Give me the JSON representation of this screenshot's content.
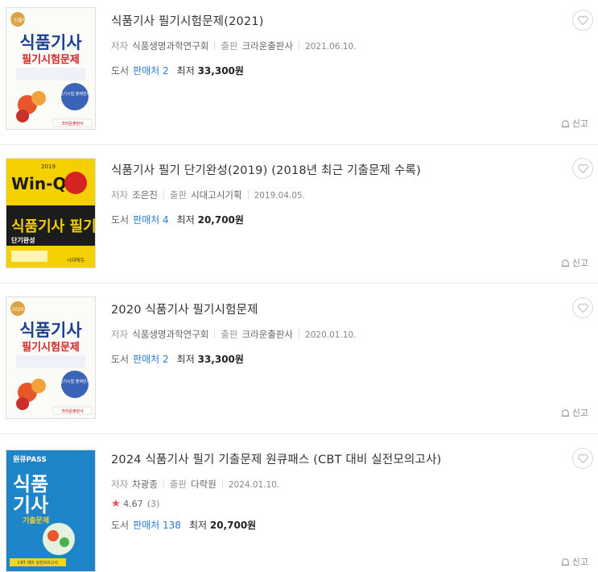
{
  "books": [
    {
      "title": "식품기사 필기시험문제(2021)",
      "author_label": "저자",
      "author": "식품생명과학연구회",
      "publisher_label": "출판",
      "publisher": "크라운출판사",
      "date": "2021.06.10.",
      "type_label": "도서",
      "sellers": "판매처 2",
      "lowest_label": "최저",
      "price": "33,300원",
      "report": "신고",
      "cover": {
        "top": "2021 신출제기준",
        "l1": "식품기사",
        "l2": "필기시험문제",
        "badge": "필기시험 출제빈도",
        "pub": "크라운출판사",
        "theme": "white"
      }
    },
    {
      "title": "식품기사 필기 단기완성(2019) (2018년 최근 기출문제 수록)",
      "author_label": "저자",
      "author": "조은진",
      "publisher_label": "출판",
      "publisher": "시대고시기획",
      "date": "2019.04.05.",
      "type_label": "도서",
      "sellers": "판매처 4",
      "lowest_label": "최저",
      "price": "20,700원",
      "report": "신고",
      "cover": {
        "top": "2019",
        "l1": "Win-Q",
        "l2": "식품기사 필기",
        "badge": "단기완성",
        "pub": "시대에듀",
        "theme": "yellow"
      }
    },
    {
      "title": "2020 식품기사 필기시험문제",
      "author_label": "저자",
      "author": "식품생명과학연구회",
      "publisher_label": "출판",
      "publisher": "크라운출판사",
      "date": "2020.01.10.",
      "type_label": "도서",
      "sellers": "판매처 2",
      "lowest_label": "최저",
      "price": "33,300원",
      "report": "신고",
      "cover": {
        "top": "2020",
        "l1": "식품기사",
        "l2": "필기시험문제",
        "badge": "필기시험 출제빈도",
        "pub": "크라운출판사",
        "theme": "white"
      }
    },
    {
      "title": "2024 식품기사 필기 기출문제 원큐패스 (CBT 대비 실전모의고사)",
      "author_label": "저자",
      "author": "차광종",
      "publisher_label": "출판",
      "publisher": "다락원",
      "date": "2024.01.10.",
      "rating": "4.67",
      "rating_count": "(3)",
      "type_label": "도서",
      "sellers": "판매처 138",
      "lowest_label": "최저",
      "price": "20,700원",
      "report": "신고",
      "cover": {
        "top": "원큐PASS",
        "l1": "식품",
        "l2": "기사",
        "badge": "기출문제",
        "pub": "CBT 대비 실전모의고사",
        "theme": "blue"
      }
    }
  ],
  "colors": {
    "seller_link": "#2b7bd3",
    "star": "#f04d4d",
    "yellow_cover": "#f4d000",
    "blue_cover": "#1e86c8",
    "red_title": "#d62323"
  }
}
